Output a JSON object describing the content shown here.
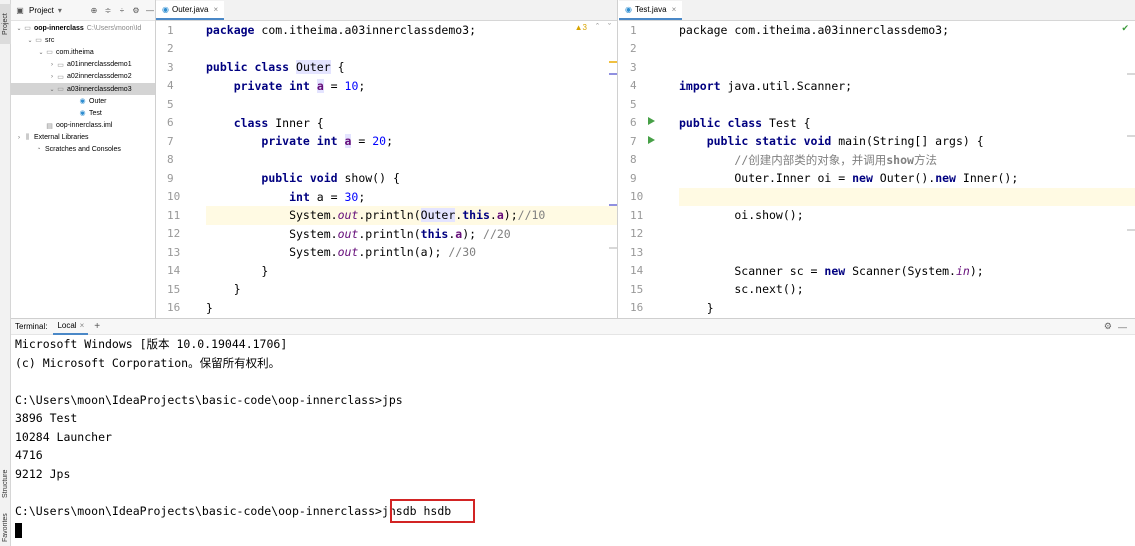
{
  "vstrip": {
    "project": "Project",
    "structure": "Structure",
    "favorites": "Favorites"
  },
  "project_panel": {
    "title": "Project",
    "dropdown": "▾",
    "tree": [
      {
        "label": "oop-innerclass",
        "path": "C:\\Users\\moon\\Id",
        "indent": 0,
        "arrow": "v",
        "icon": "folder",
        "bold": true
      },
      {
        "label": "src",
        "indent": 1,
        "arrow": "v",
        "icon": "folder"
      },
      {
        "label": "com.itheima",
        "indent": 2,
        "arrow": "v",
        "icon": "package"
      },
      {
        "label": "a01innerclassdemo1",
        "indent": 3,
        "arrow": ">",
        "icon": "package"
      },
      {
        "label": "a02innerclassdemo2",
        "indent": 3,
        "arrow": ">",
        "icon": "package"
      },
      {
        "label": "a03innerclassdemo3",
        "indent": 3,
        "arrow": "v",
        "icon": "package",
        "selected": true
      },
      {
        "label": "Outer",
        "indent": 5,
        "arrow": "",
        "icon": "class"
      },
      {
        "label": "Test",
        "indent": 5,
        "arrow": "",
        "icon": "class"
      },
      {
        "label": "oop-innerclass.iml",
        "indent": 2,
        "arrow": "",
        "icon": "file"
      },
      {
        "label": "External Libraries",
        "indent": 0,
        "arrow": ">",
        "icon": "lib"
      },
      {
        "label": "Scratches and Consoles",
        "indent": 1,
        "arrow": "",
        "icon": "scratch"
      }
    ]
  },
  "editor_left": {
    "tab": "Outer.java",
    "warnings": "▲3",
    "line_numbers": [
      "1",
      "2",
      "3",
      "4",
      "5",
      "6",
      "7",
      "8",
      "9",
      "10",
      "11",
      "12",
      "13",
      "14",
      "15",
      "16"
    ]
  },
  "editor_right": {
    "tab": "Test.java",
    "line_numbers": [
      "1",
      "2",
      "3",
      "4",
      "5",
      "6",
      "7",
      "8",
      "9",
      "10",
      "11",
      "12",
      "13",
      "14",
      "15",
      "16"
    ]
  },
  "terminal": {
    "tab_label": "Terminal:",
    "local_tab": "Local",
    "add": "+",
    "lines": [
      "Microsoft Windows [版本 10.0.19044.1706]",
      "(c) Microsoft Corporation。保留所有权利。",
      "",
      "C:\\Users\\moon\\IdeaProjects\\basic-code\\oop-innerclass>jps",
      "3896 Test",
      "10284 Launcher",
      "4716",
      "9212 Jps",
      "",
      "C:\\Users\\moon\\IdeaProjects\\basic-code\\oop-innerclass>jhsdb hsdb"
    ]
  },
  "colors": {
    "accent": "#4a88c7",
    "highlight_box": "#d22424",
    "run_arrow": "#47a047"
  }
}
